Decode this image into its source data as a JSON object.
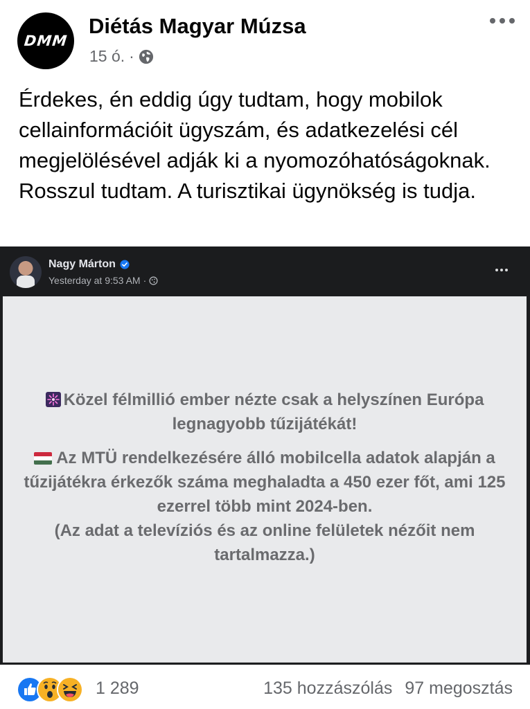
{
  "post": {
    "avatar_text": "DMM",
    "page_name": "Diétás Magyar Múzsa",
    "time": "15 ó.",
    "separator": "·",
    "caption": "Érdekes, én eddig úgy tudtam, hogy mobilok cellainformációit ügyszám, és adatkezelési cél megjelölésével adják ki a nyomozóhatóságoknak. Rosszul tudtam. A turisztikai ügynökség is tudja."
  },
  "shared": {
    "author": "Nagy Márton",
    "time": "Yesterday at 9:53 AM",
    "separator": "·",
    "paragraph1": "Közel félmillió ember nézte csak a helyszínen Európa legnagyobb tűzijátékát!",
    "paragraph2": "Az MTÜ rendelkezésére álló mobilcella adatok alapján a tűzijátékra érkezők száma meghaladta a 450 ezer főt, ami 125 ezerrel több mint 2024-ben.",
    "paragraph3": "(Az adat a televíziós és az online felületek nézőit nem tartalmazza.)"
  },
  "footer": {
    "reaction_count": "1 289",
    "comments": "135 hozzászólás",
    "shares": "97 megosztás",
    "reaction_icons": [
      "like-icon",
      "wow-icon",
      "haha-icon"
    ]
  },
  "colors": {
    "like": "#1877f2",
    "reaction_yellow": "#f7b125",
    "secondary_text": "#65676b",
    "embed_body": "#e9eaec",
    "embed_header": "#1b1c1e"
  }
}
